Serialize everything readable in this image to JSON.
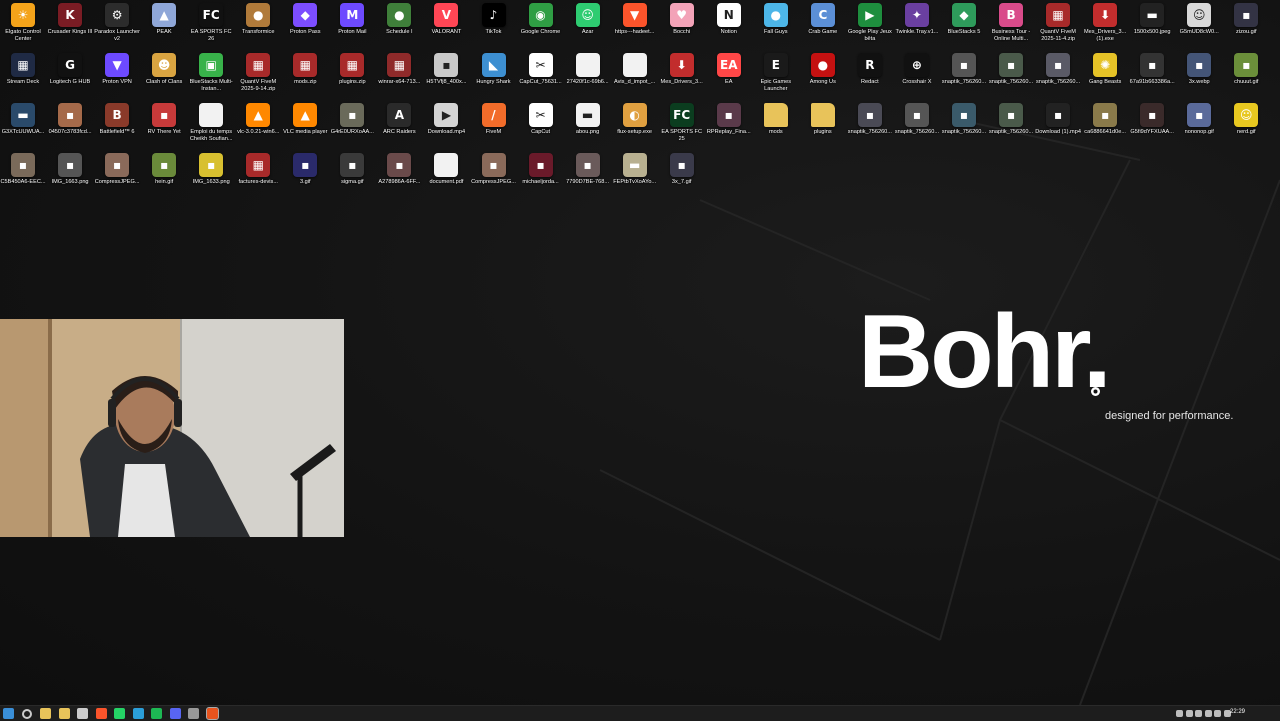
{
  "desktop": {
    "icons": [
      {
        "label": "Elgato Control Center",
        "icon": "elgato-icon",
        "color": "#f4a31a",
        "glyph": "☀"
      },
      {
        "label": "Crusader Kings III",
        "icon": "crusader-kings-icon",
        "color": "#7a1c24",
        "glyph": "K"
      },
      {
        "label": "Paradox Launcher v2",
        "icon": "paradox-icon",
        "color": "#2c2c2c",
        "glyph": "⚙"
      },
      {
        "label": "PEAK",
        "icon": "peak-icon",
        "color": "#8fa7d8",
        "glyph": "▲"
      },
      {
        "label": "EA SPORTS FC 26",
        "icon": "ea-fc-26-icon",
        "color": "#111111",
        "glyph": "FC"
      },
      {
        "label": "Transformice",
        "icon": "transformice-icon",
        "color": "#b07a3a",
        "glyph": "●"
      },
      {
        "label": "Proton Pass",
        "icon": "proton-pass-icon",
        "color": "#7c4dff",
        "glyph": "◆"
      },
      {
        "label": "Proton Mail",
        "icon": "proton-mail-icon",
        "color": "#6d4aff",
        "glyph": "M"
      },
      {
        "label": "Schedule I",
        "icon": "schedule-i-icon",
        "color": "#3f7f3a",
        "glyph": "●"
      },
      {
        "label": "VALORANT",
        "icon": "valorant-icon",
        "color": "#ff4655",
        "glyph": "V"
      },
      {
        "label": "TikTok",
        "icon": "tiktok-icon",
        "color": "#000000",
        "glyph": "♪"
      },
      {
        "label": "Google Chrome",
        "icon": "chrome-icon",
        "color": "#2f9e44",
        "glyph": "◉"
      },
      {
        "label": "Azar",
        "icon": "azar-icon",
        "color": "#2ecc71",
        "glyph": "☺"
      },
      {
        "label": "https---hadeet...",
        "icon": "brave-icon",
        "color": "#fb542b",
        "glyph": "▼"
      },
      {
        "label": "Bocchi",
        "icon": "bocchi-icon",
        "color": "#f3a3b8",
        "glyph": "♥"
      },
      {
        "label": "Notion",
        "icon": "notion-icon",
        "color": "#ffffff",
        "glyph": "N"
      },
      {
        "label": "Fall Guys",
        "icon": "fall-guys-icon",
        "color": "#4db6e8",
        "glyph": "●"
      },
      {
        "label": "Crab Game",
        "icon": "crab-game-icon",
        "color": "#5b8fd6",
        "glyph": "C"
      },
      {
        "label": "Google Play Jeux bêta",
        "icon": "google-play-games-icon",
        "color": "#1e8e3e",
        "glyph": "▶"
      },
      {
        "label": "Twinkle.Tray.v1...",
        "icon": "twinkle-tray-icon",
        "color": "#6a3fa0",
        "glyph": "✦"
      },
      {
        "label": "BlueStacks 5",
        "icon": "bluestacks-icon",
        "color": "#2e9b5b",
        "glyph": "◆"
      },
      {
        "label": "Business Tour - Online Multi...",
        "icon": "business-tour-icon",
        "color": "#d94b8a",
        "glyph": "B"
      },
      {
        "label": "QuantV FiveM 2025-11-4.zip",
        "icon": "winrar-archive-icon",
        "color": "#a82a2a",
        "glyph": "▦"
      },
      {
        "label": "Mes_Drivers_3... (1).exe",
        "icon": "installer-icon",
        "color": "#c22d2d",
        "glyph": "⬇"
      },
      {
        "label": "1500x500.jpeg",
        "icon": "image-file-icon",
        "color": "#222222",
        "glyph": "▬"
      },
      {
        "label": "G5mUD8cW0...",
        "icon": "image-file-icon",
        "color": "#d8d8d8",
        "glyph": "☺"
      },
      {
        "label": "zizou.gif",
        "icon": "gif-file-icon",
        "color": "#333344",
        "glyph": "▪"
      },
      {
        "label": "Stream Deck",
        "icon": "stream-deck-icon",
        "color": "#1f2a44",
        "glyph": "▦"
      },
      {
        "label": "Logitech G HUB",
        "icon": "logitech-ghub-icon",
        "color": "#111111",
        "glyph": "G"
      },
      {
        "label": "Proton VPN",
        "icon": "proton-vpn-icon",
        "color": "#6d4aff",
        "glyph": "▼"
      },
      {
        "label": "Clash of Clans",
        "icon": "clash-of-clans-icon",
        "color": "#d9a441",
        "glyph": "☻"
      },
      {
        "label": "BlueStacks Multi-Instan...",
        "icon": "bluestacks-multi-icon",
        "color": "#38b24a",
        "glyph": "▣"
      },
      {
        "label": "QuantV FiveM 2025-9-14.zip",
        "icon": "winrar-archive-icon",
        "color": "#a82a2a",
        "glyph": "▦"
      },
      {
        "label": "mods.zip",
        "icon": "winrar-archive-icon",
        "color": "#a82a2a",
        "glyph": "▦"
      },
      {
        "label": "plugins.zip",
        "icon": "winrar-archive-icon",
        "color": "#a82a2a",
        "glyph": "▦"
      },
      {
        "label": "winrar-x64-713...",
        "icon": "winrar-installer-icon",
        "color": "#8f2a2a",
        "glyph": "▦"
      },
      {
        "label": "H5TVfj8_400x...",
        "icon": "image-file-icon",
        "color": "#c9c9c9",
        "glyph": "▪"
      },
      {
        "label": "Hungry Shark",
        "icon": "hungry-shark-icon",
        "color": "#3d8fd1",
        "glyph": "◣"
      },
      {
        "label": "CapCut_75631...",
        "icon": "capcut-icon",
        "color": "#ffffff",
        "glyph": "✂"
      },
      {
        "label": "27420f1c-69b6...",
        "icon": "document-file-icon",
        "color": "#f2f2f2",
        "glyph": ""
      },
      {
        "label": "Avis_d_impot_...",
        "icon": "document-file-icon",
        "color": "#f2f2f2",
        "glyph": ""
      },
      {
        "label": "Mes_Drivers_3...",
        "icon": "installer-icon",
        "color": "#c22d2d",
        "glyph": "⬇"
      },
      {
        "label": "EA",
        "icon": "ea-icon",
        "color": "#ff4747",
        "glyph": "EA"
      },
      {
        "label": "Epic Games Launcher",
        "icon": "epic-games-icon",
        "color": "#1a1a1a",
        "glyph": "E"
      },
      {
        "label": "Among Us",
        "icon": "among-us-icon",
        "color": "#c51111",
        "glyph": "●"
      },
      {
        "label": "Redact",
        "icon": "redact-icon",
        "color": "#111111",
        "glyph": "R"
      },
      {
        "label": "Crosshair X",
        "icon": "crosshair-x-icon",
        "color": "#111111",
        "glyph": "⊕"
      },
      {
        "label": "snaptik_756260...",
        "icon": "video-file-icon",
        "color": "#555555",
        "glyph": "▪"
      },
      {
        "label": "snaptik_756260...",
        "icon": "video-file-icon",
        "color": "#4a5a4a",
        "glyph": "▪"
      },
      {
        "label": "snaptik_756260...",
        "icon": "video-file-icon",
        "color": "#5a5a66",
        "glyph": "▪"
      },
      {
        "label": "Gang Beasts",
        "icon": "gang-beasts-icon",
        "color": "#e5c227",
        "glyph": "✺"
      },
      {
        "label": "67a91b663386a...",
        "icon": "video-file-icon",
        "color": "#333333",
        "glyph": "▪"
      },
      {
        "label": "3x.webp",
        "icon": "image-file-icon",
        "color": "#445577",
        "glyph": "▪"
      },
      {
        "label": "chuuut.gif",
        "icon": "gif-file-icon",
        "color": "#6b8f3a",
        "glyph": "▪"
      },
      {
        "label": "G3XTcUUWUA...",
        "icon": "image-file-icon",
        "color": "#2a4a6a",
        "glyph": "▬"
      },
      {
        "label": "04507c3783fcd...",
        "icon": "image-file-icon",
        "color": "#a56a4a",
        "glyph": "▪"
      },
      {
        "label": "Battlefield™ 6",
        "icon": "battlefield-icon",
        "color": "#8a3a2a",
        "glyph": "B"
      },
      {
        "label": "RV There Yet",
        "icon": "rv-there-yet-icon",
        "color": "#c73a3a",
        "glyph": "▪"
      },
      {
        "label": "Emploi du temps Cheikh Soufian...",
        "icon": "document-file-icon",
        "color": "#f2f2f2",
        "glyph": ""
      },
      {
        "label": "vlc-3.0.21-win6...",
        "icon": "vlc-installer-icon",
        "color": "#ff8800",
        "glyph": "▲"
      },
      {
        "label": "VLC media player",
        "icon": "vlc-icon",
        "color": "#ff8800",
        "glyph": "▲"
      },
      {
        "label": "G4rE0URXoAA...",
        "icon": "image-file-icon",
        "color": "#6a6a5a",
        "glyph": "▪"
      },
      {
        "label": "ARC Raiders",
        "icon": "arc-raiders-icon",
        "color": "#2a2a2a",
        "glyph": "A"
      },
      {
        "label": "Download.mp4",
        "icon": "video-file-icon",
        "color": "#d4d4d4",
        "glyph": "▶"
      },
      {
        "label": "FiveM",
        "icon": "fivem-icon",
        "color": "#f26c2a",
        "glyph": "/"
      },
      {
        "label": "CapCut",
        "icon": "capcut-icon",
        "color": "#ffffff",
        "glyph": "✂"
      },
      {
        "label": "abou.png",
        "icon": "image-file-icon",
        "color": "#f2f2f2",
        "glyph": "▬"
      },
      {
        "label": "flux-setup.exe",
        "icon": "flux-icon",
        "color": "#e0a040",
        "glyph": "◐"
      },
      {
        "label": "EA SPORTS FC 25",
        "icon": "ea-fc-25-icon",
        "color": "#0b3d1f",
        "glyph": "FC"
      },
      {
        "label": "RPReplay_Fina...",
        "icon": "video-file-icon",
        "color": "#5a3a4a",
        "glyph": "▪"
      },
      {
        "label": "mods",
        "icon": "folder-icon",
        "color": "#e8c35a",
        "glyph": ""
      },
      {
        "label": "plugins",
        "icon": "folder-icon",
        "color": "#e8c35a",
        "glyph": ""
      },
      {
        "label": "snaptik_756260...",
        "icon": "video-file-icon",
        "color": "#4a4a55",
        "glyph": "▪"
      },
      {
        "label": "snaptik_756260...",
        "icon": "video-file-icon",
        "color": "#555555",
        "glyph": "▪"
      },
      {
        "label": "snaptik_756260...",
        "icon": "video-file-icon",
        "color": "#3a5a6a",
        "glyph": "▪"
      },
      {
        "label": "snaptik_756260...",
        "icon": "video-file-icon",
        "color": "#4a5a4a",
        "glyph": "▪"
      },
      {
        "label": "Download (1).mp4",
        "icon": "video-file-icon",
        "color": "#222222",
        "glyph": "▪"
      },
      {
        "label": "ca6886641d0e...",
        "icon": "image-file-icon",
        "color": "#8a7a4a",
        "glyph": "▪"
      },
      {
        "label": "G5fi9dYFXUAA...",
        "icon": "image-file-icon",
        "color": "#3a2a2a",
        "glyph": "▪"
      },
      {
        "label": "nononop.gif",
        "icon": "gif-file-icon",
        "color": "#5a6a9a",
        "glyph": "▪"
      },
      {
        "label": "nerd.gif",
        "icon": "gif-file-icon",
        "color": "#e8c820",
        "glyph": "☺"
      },
      {
        "label": "C5B450A6-EEC...",
        "icon": "image-file-icon",
        "color": "#7a6a5a",
        "glyph": "▪"
      },
      {
        "label": "IMG_1663.png",
        "icon": "image-file-icon",
        "color": "#555555",
        "glyph": "▪"
      },
      {
        "label": "CompressJPEG...",
        "icon": "image-file-icon",
        "color": "#8a6a5a",
        "glyph": "▪"
      },
      {
        "label": "hein.gif",
        "icon": "gif-file-icon",
        "color": "#6a8a3a",
        "glyph": "▪"
      },
      {
        "label": "IMG_1633.png",
        "icon": "image-file-icon",
        "color": "#d8c030",
        "glyph": "▪"
      },
      {
        "label": "factures-devis...",
        "icon": "winrar-archive-icon",
        "color": "#a82a2a",
        "glyph": "▦"
      },
      {
        "label": "3.gif",
        "icon": "gif-file-icon",
        "color": "#2a2a6a",
        "glyph": "▪"
      },
      {
        "label": "sigma.gif",
        "icon": "gif-file-icon",
        "color": "#3a3a3a",
        "glyph": "▪"
      },
      {
        "label": "A278986A-6FF...",
        "icon": "image-file-icon",
        "color": "#6a4a4a",
        "glyph": "▪"
      },
      {
        "label": "document.pdf",
        "icon": "pdf-file-icon",
        "color": "#f2f2f2",
        "glyph": ""
      },
      {
        "label": "CompressJPEG...",
        "icon": "image-file-icon",
        "color": "#8a6a5a",
        "glyph": "▪"
      },
      {
        "label": "michaeljorda...",
        "icon": "image-file-icon",
        "color": "#6a1a2a",
        "glyph": "▪"
      },
      {
        "label": "7790D7BE-768...",
        "icon": "image-file-icon",
        "color": "#6a5a5a",
        "glyph": "▪"
      },
      {
        "label": "FEPtbTvXoAYo...",
        "icon": "image-file-icon",
        "color": "#b8b090",
        "glyph": "▬"
      },
      {
        "label": "3x_7.gif",
        "icon": "gif-file-icon",
        "color": "#3a3a4a",
        "glyph": "▪"
      }
    ],
    "row_lengths": [
      27,
      27,
      27,
      15
    ]
  },
  "brand": {
    "name": "Bohr.",
    "tagline": "designed for performance."
  },
  "taskbar": {
    "clock": "22:29",
    "apps": [
      {
        "icon": "start-icon",
        "color": "#3a8fd8"
      },
      {
        "icon": "search-icon",
        "color": "#cccccc"
      },
      {
        "icon": "file-explorer-icon",
        "color": "#e8c35a"
      },
      {
        "icon": "explorer-icon",
        "color": "#e8c35a"
      },
      {
        "icon": "store-icon",
        "color": "#cccccc"
      },
      {
        "icon": "brave-icon",
        "color": "#fb542b"
      },
      {
        "icon": "whatsapp-icon",
        "color": "#25d366"
      },
      {
        "icon": "edge-icon",
        "color": "#2b9fd9"
      },
      {
        "icon": "spotify-icon",
        "color": "#1db954"
      },
      {
        "icon": "discord-icon",
        "color": "#5865f2"
      },
      {
        "icon": "obs-icon",
        "color": "#999999"
      },
      {
        "icon": "recording-app-icon",
        "color": "#e8541e"
      }
    ],
    "tray_icons": [
      "chevron-up-icon",
      "network-icon",
      "cloud-icon",
      "speaker-icon",
      "keyboard-icon",
      "display-icon"
    ]
  }
}
